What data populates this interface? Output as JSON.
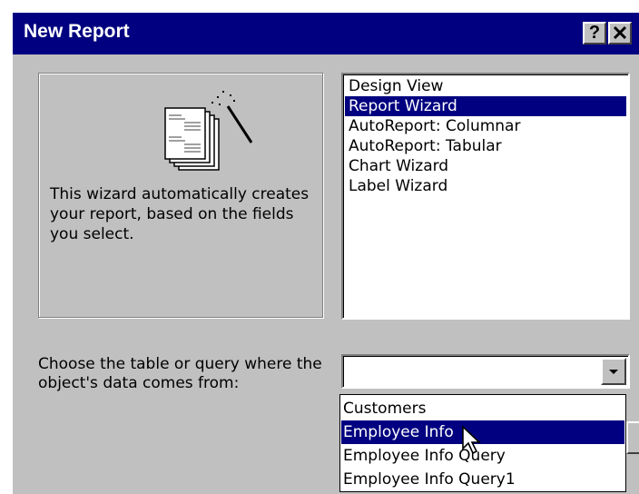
{
  "window": {
    "title": "New Report",
    "help_label": "?",
    "close_label": "✕"
  },
  "preview": {
    "description": "This wizard automatically creates your report, based on the fields you select.",
    "icon": "report-wizard-icon"
  },
  "report_types": {
    "items": [
      "Design View",
      "Report Wizard",
      "AutoReport:  Columnar",
      "AutoReport:  Tabular",
      "Chart Wizard",
      "Label Wizard"
    ],
    "selected": "Report Wizard"
  },
  "source": {
    "prompt": "Choose the table or query where the object's data comes from:",
    "value": "",
    "options": [
      "Customers",
      "Employee Info",
      "Employee Info Query",
      "Employee Info Query1"
    ],
    "highlighted": "Employee Info"
  },
  "colors": {
    "titlebar": "#000080",
    "face": "#c0c0c0",
    "selection": "#000080"
  }
}
